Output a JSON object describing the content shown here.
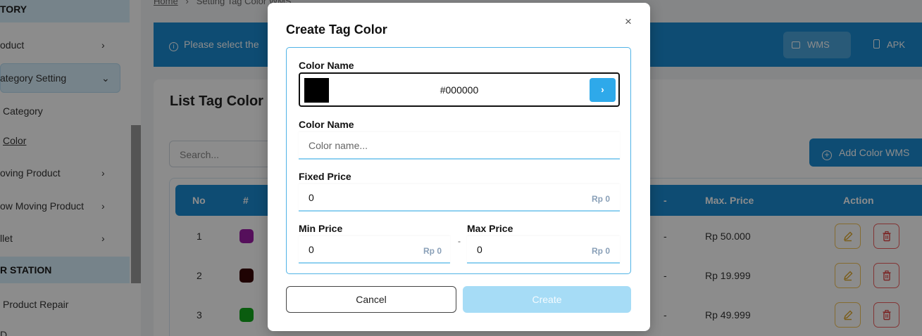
{
  "sidebar": {
    "sections": [
      "TORY",
      "R STATION"
    ],
    "items": [
      {
        "label": "oduct",
        "chevron": "›"
      },
      {
        "label": "ategory Setting",
        "chevron": "⌄"
      },
      {
        "label": "Category"
      },
      {
        "label": "Color"
      },
      {
        "label": "oving Product",
        "chevron": "›"
      },
      {
        "label": "ow Moving Product",
        "chevron": "›"
      },
      {
        "label": "llet",
        "chevron": "›"
      },
      {
        "label": "Product Repair"
      },
      {
        "label": "D"
      }
    ]
  },
  "breadcrumb": {
    "home": "Home",
    "sep": "›",
    "current": "Setting Tag Color WMS"
  },
  "info_bar": {
    "text": "Please select the",
    "wms_label": "WMS",
    "apk_label": "APK",
    "info_icon": "info-icon"
  },
  "list": {
    "title": "List Tag Color",
    "search_placeholder": "Search...",
    "add_label": "Add Color WMS",
    "headers": {
      "no": "No",
      "hash": "#",
      "dash": "-",
      "max_price": "Max. Price",
      "action": "Action"
    },
    "rows": [
      {
        "no": "1",
        "color": "#9c1da6",
        "dash": "-",
        "max_price": "Rp 50.000"
      },
      {
        "no": "2",
        "color": "#3a0606",
        "dash": "-",
        "max_price": "Rp 19.999"
      },
      {
        "no": "3",
        "color": "#13a81c",
        "dash": "-",
        "max_price": "Rp 49.999"
      }
    ]
  },
  "modal": {
    "title": "Create Tag Color",
    "close": "×",
    "color_picker_label": "Color Name",
    "color_hex": "#000000",
    "color_swatch": "#000000",
    "color_go": "›",
    "name_label": "Color Name",
    "name_placeholder": "Color name...",
    "fixed_price_label": "Fixed Price",
    "fixed_price_value": "0",
    "fixed_price_suffix": "Rp 0",
    "min_price_label": "Min Price",
    "min_price_value": "0",
    "min_price_suffix": "Rp 0",
    "range_sep": "-",
    "max_price_label": "Max Price",
    "max_price_value": "0",
    "max_price_suffix": "Rp 0",
    "cancel_label": "Cancel",
    "create_label": "Create"
  },
  "colors": {
    "accent": "#1a8bd1",
    "accent_light": "#a6dcf6",
    "edit": "#f3c458",
    "delete": "#ee5f5f"
  }
}
